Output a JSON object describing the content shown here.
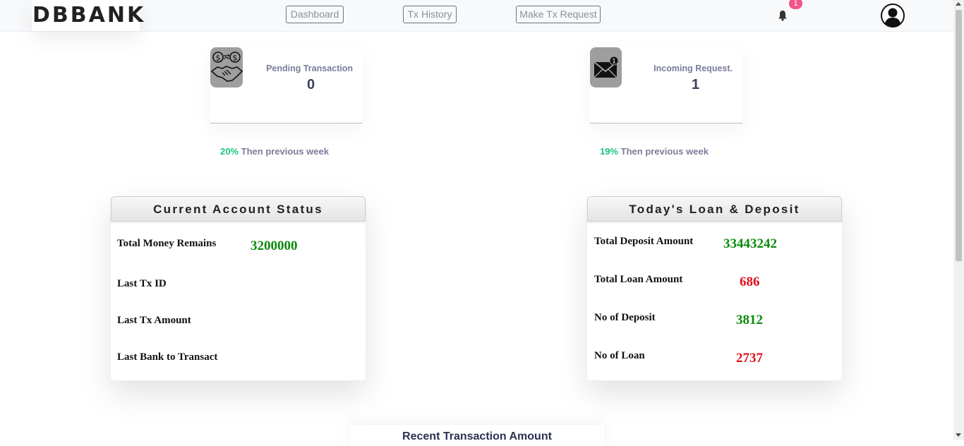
{
  "navbar": {
    "brand": "DBBANK",
    "links": [
      "Dashboard",
      "Tx History",
      "Make Tx Request"
    ],
    "notification_count": "1"
  },
  "stats": [
    {
      "label": "Pending Transaction",
      "value": "0",
      "change_pct": "20%",
      "change_text": "Then previous week",
      "icon": "handshake-money-icon"
    },
    {
      "label": "Incoming Request.",
      "value": "1",
      "change_pct": "19%",
      "change_text": "Then previous week",
      "icon": "envelope-notification-icon"
    }
  ],
  "account_status": {
    "title": "Current Account Status",
    "rows": [
      {
        "label": "Total Money Remains",
        "value": "3200000"
      },
      {
        "label": "Last Tx ID",
        "value": ""
      },
      {
        "label": "Last Tx Amount",
        "value": ""
      },
      {
        "label": "Last Bank to Transact",
        "value": ""
      }
    ]
  },
  "loan_deposit": {
    "title": "Today's Loan & Deposit",
    "rows": [
      {
        "label": "Total Deposit Amount",
        "value": "33443242",
        "color": "#0a8a0a"
      },
      {
        "label": "Total Loan Amount",
        "value": "686",
        "color": "#e0101a"
      },
      {
        "label": "No of Deposit",
        "value": "3812",
        "color": "#0a8a0a"
      },
      {
        "label": "No of Loan",
        "value": "2737",
        "color": "#e0101a"
      }
    ]
  },
  "recent": {
    "title": "Recent Transaction Amount"
  },
  "colors": {
    "positive_pct": "#1bc47d",
    "badge": "#f0548a"
  }
}
